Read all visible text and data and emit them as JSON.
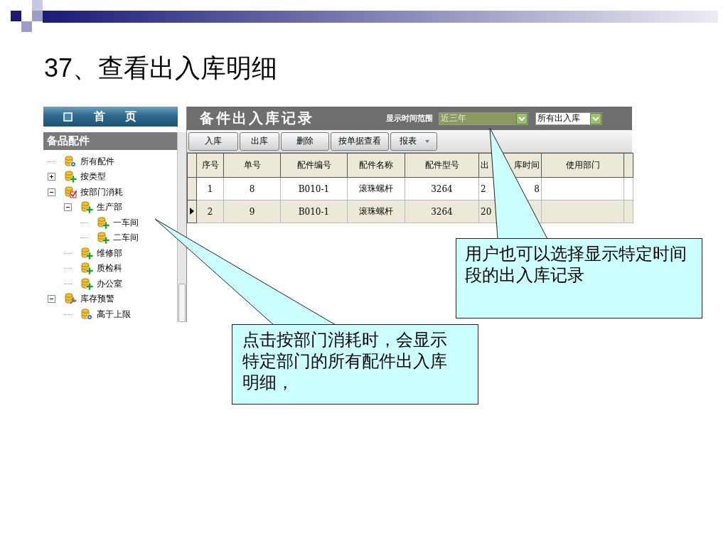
{
  "slide": {
    "title": "37、查看出入库明细"
  },
  "app": {
    "home_tab": {
      "label": "首 页"
    },
    "tree": {
      "title": "备品配件",
      "items": [
        {
          "label": "所有配件",
          "kind": "gear"
        },
        {
          "label": "按类型",
          "kind": "plus",
          "expanded": false
        },
        {
          "label": "按部门消耗",
          "kind": "check",
          "expanded": true,
          "children": [
            {
              "label": "生产部",
              "kind": "plus",
              "expanded": true,
              "children": [
                {
                  "label": "一车间",
                  "kind": "plus"
                },
                {
                  "label": "二车间",
                  "kind": "plus"
                }
              ]
            },
            {
              "label": "维修部",
              "kind": "plus"
            },
            {
              "label": "质检科",
              "kind": "plus"
            },
            {
              "label": "办公室",
              "kind": "plus"
            }
          ]
        },
        {
          "label": "库存预警",
          "kind": "wrench",
          "expanded": true,
          "children": [
            {
              "label": "高于上限",
              "kind": "gear"
            }
          ]
        }
      ]
    },
    "records": {
      "title": "备件出入库记录",
      "range_label": "显示时间范围",
      "range_select": {
        "value": "近三年"
      },
      "type_select": {
        "value": "所有出入库"
      },
      "toolbar": [
        {
          "label": "入库",
          "kind": "button"
        },
        {
          "label": "出库",
          "kind": "button"
        },
        {
          "label": "删除",
          "kind": "button"
        },
        {
          "label": "按单据查看",
          "kind": "button"
        },
        {
          "label": "报表",
          "kind": "menu"
        }
      ],
      "table": {
        "columns": [
          {
            "label": "序号"
          },
          {
            "label": "单号"
          },
          {
            "label": "配件编号"
          },
          {
            "label": "配件名称"
          },
          {
            "label": "配件型号"
          },
          {
            "parts": [
              "出",
              "库时间"
            ]
          },
          {
            "label": "使用部门"
          }
        ],
        "rows": [
          {
            "selected": false,
            "cells": [
              "1",
              "8",
              "B010-1",
              "滚珠螺杆",
              "3264",
              {
                "parts": [
                  "2",
                  "8"
                ]
              }
            ]
          },
          {
            "selected": true,
            "cells": [
              "2",
              "9",
              "B010-1",
              "滚珠螺杆",
              "3264",
              {
                "parts": [
                  "20"
                ]
              }
            ]
          }
        ]
      }
    }
  },
  "callouts": [
    {
      "text": "用户也可以选择显示特定时间段的出入库记录"
    },
    {
      "text": "点击按部门消耗时，会显示特定部门的所有配件出入库明细，"
    }
  ]
}
